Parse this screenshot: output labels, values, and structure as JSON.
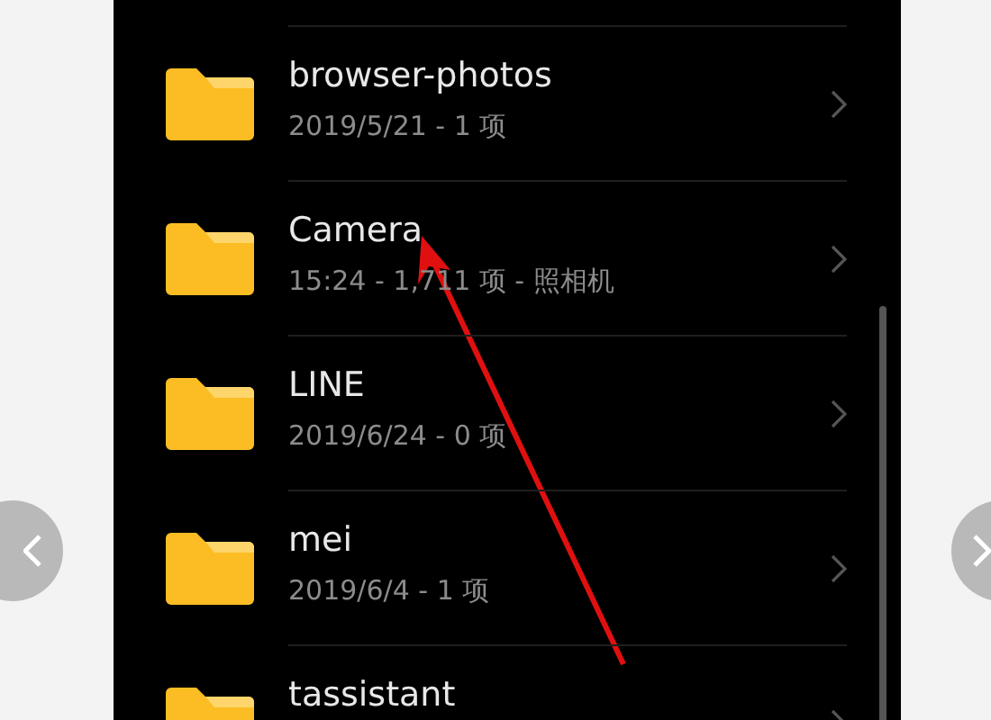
{
  "folders": [
    {
      "name": "browser-photos",
      "details": "2019/5/21 - 1 项"
    },
    {
      "name": "Camera",
      "details": "15:24 - 1,711 项 - 照相机"
    },
    {
      "name": "LINE",
      "details": "2019/6/24 - 0 项"
    },
    {
      "name": "mei",
      "details": "2019/6/4 - 1 项"
    },
    {
      "name": "tassistant"
    }
  ]
}
